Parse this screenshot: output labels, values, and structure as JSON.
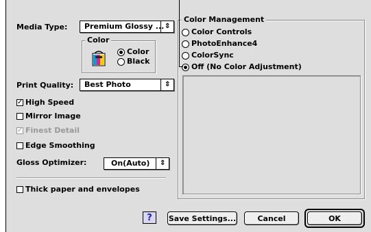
{
  "media": {
    "label": "Media Type:",
    "value": "Premium Glossy ...",
    "arrow": "updown-arrows-icon"
  },
  "color_group": {
    "title": "Color",
    "options": [
      "Color",
      "Black"
    ],
    "selected": "Color",
    "icon": "ink-cartridge-icon"
  },
  "print_quality": {
    "label": "Print Quality:",
    "value": "Best Photo"
  },
  "options": {
    "high_speed": {
      "label": "High Speed",
      "checked": true
    },
    "mirror_image": {
      "label": "Mirror Image",
      "checked": false
    },
    "finest_detail": {
      "label": "Finest Detail",
      "checked": true,
      "disabled": true
    },
    "edge_smoothing": {
      "label": "Edge Smoothing",
      "checked": false
    }
  },
  "gloss": {
    "label": "Gloss Optimizer:",
    "value": "On(Auto)"
  },
  "thick_paper": {
    "label": "Thick paper and envelopes",
    "checked": false
  },
  "color_management": {
    "title": "Color Management",
    "options": [
      "Color Controls",
      "PhotoEnhance4",
      "ColorSync",
      "Off (No Color Adjustment)"
    ],
    "selected": "Off (No Color Adjustment)"
  },
  "buttons": {
    "help": "?",
    "save": "Save Settings...",
    "cancel": "Cancel",
    "ok": "OK"
  },
  "colors": {
    "dialog_bg": "#dedede",
    "help_blue": "#1e1ebe"
  }
}
